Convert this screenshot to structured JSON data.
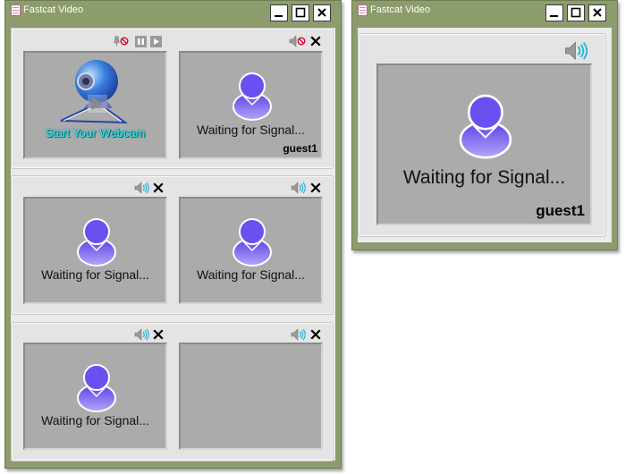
{
  "left_window": {
    "title": "Fastcat Video",
    "webcam_tile": {
      "label": "Start Your Webcam"
    },
    "tiles": [
      {
        "status": "Waiting for Signal...",
        "guest": "guest1"
      },
      {
        "status": "Waiting for Signal...",
        "guest": ""
      },
      {
        "status": "Waiting for Signal...",
        "guest": ""
      },
      {
        "status": "Waiting for Signal...",
        "guest": ""
      },
      {
        "status": "",
        "guest": ""
      }
    ]
  },
  "right_window": {
    "title": "Fastcat Video",
    "tile": {
      "status": "Waiting for Signal...",
      "guest": "guest1"
    }
  },
  "icons": {
    "minimize": "minimize-icon",
    "maximize": "maximize-icon",
    "close": "close-icon",
    "speaker": "speaker-icon",
    "speaker_muted": "speaker-muted-icon",
    "mic_muted": "microphone-muted-icon",
    "pause": "pause-icon",
    "play": "play-icon",
    "webcam": "webcam-icon",
    "user_avatar": "user-avatar-icon"
  },
  "colors": {
    "window_frame": "#8c9c6c",
    "avatar": "#6b4ff0",
    "speaker_wave": "#1fb7dc",
    "mute_slash": "#e0002a",
    "webcam_text": "#2ee8f0"
  }
}
